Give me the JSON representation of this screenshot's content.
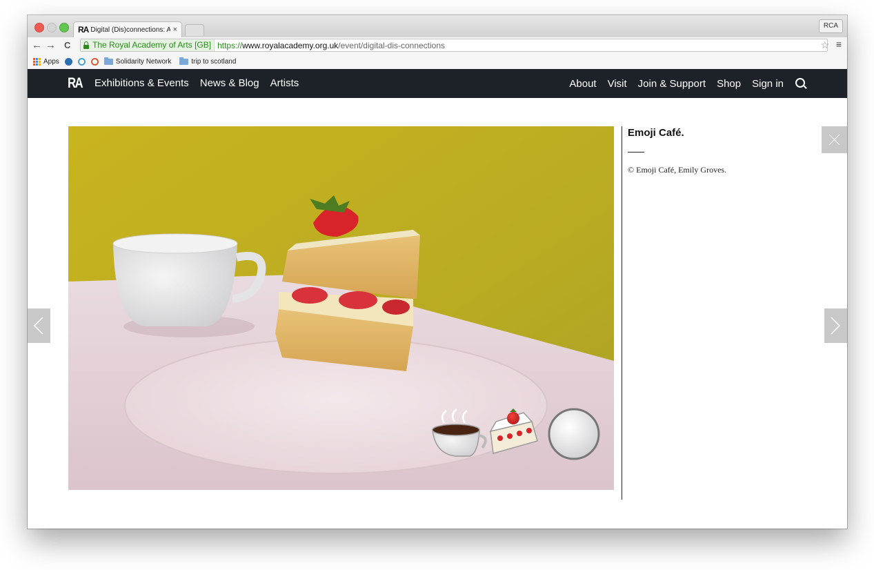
{
  "browser": {
    "tab_icon_text": "RA",
    "tab_title": "Digital (Dis)connections: A",
    "tab_close": "×",
    "profile": "RCA",
    "back": "←",
    "forward": "→",
    "reload": "C",
    "ev_label": "The Royal Academy of Arts [GB]",
    "url_scheme": "https://",
    "url_host": "www.royalacademy.org.uk",
    "url_path": "/event/digital-dis-connections",
    "star": "☆",
    "menu": "≡"
  },
  "bookmarks": {
    "apps": "Apps",
    "items": [
      "Solidarity Network",
      "trip to scotland"
    ]
  },
  "site_nav": {
    "logo": "RA",
    "left": [
      "Exhibitions & Events",
      "News & Blog",
      "Artists"
    ],
    "right": [
      "About",
      "Visit",
      "Join & Support",
      "Shop",
      "Sign in"
    ]
  },
  "lightbox": {
    "title": "Emoji Café.",
    "credit": "© Emoji Café, Emily Groves."
  },
  "colors": {
    "nav_bg": "#1c2228",
    "photo_wall": "#c4b321",
    "overlay_btn": "#c8c8c8"
  }
}
